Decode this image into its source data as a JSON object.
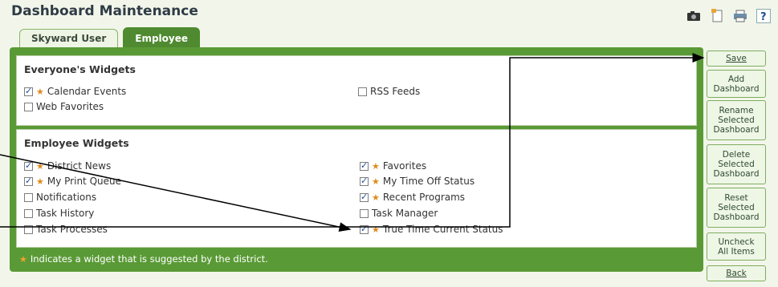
{
  "header": {
    "title": "Dashboard Maintenance"
  },
  "toolbar_icons": [
    "camera-icon",
    "page-icon",
    "print-icon",
    "help-icon"
  ],
  "tabs": [
    {
      "label": "Skyward User"
    },
    {
      "label": "Employee"
    }
  ],
  "everyone": {
    "heading": "Everyone's Widgets",
    "items": [
      {
        "label": "Calendar Events",
        "checked": true,
        "suggested": true
      },
      {
        "label": "Web Favorites",
        "checked": false,
        "suggested": false
      },
      {
        "label": "RSS Feeds",
        "checked": false,
        "suggested": false
      }
    ]
  },
  "employee": {
    "heading": "Employee Widgets",
    "items": [
      {
        "label": "District News",
        "checked": true,
        "suggested": true
      },
      {
        "label": "My Print Queue",
        "checked": true,
        "suggested": true
      },
      {
        "label": "Notifications",
        "checked": false,
        "suggested": false
      },
      {
        "label": "Task History",
        "checked": false,
        "suggested": false
      },
      {
        "label": "Task Processes",
        "checked": false,
        "suggested": false
      },
      {
        "label": "Favorites",
        "checked": true,
        "suggested": true
      },
      {
        "label": "My Time Off Status",
        "checked": true,
        "suggested": true
      },
      {
        "label": "Recent Programs",
        "checked": true,
        "suggested": true
      },
      {
        "label": "Task Manager",
        "checked": false,
        "suggested": false
      },
      {
        "label": "True Time Current Status",
        "checked": true,
        "suggested": true
      }
    ]
  },
  "legend": {
    "text": "Indicates a widget that is suggested by the district."
  },
  "buttons": {
    "save": "Save",
    "add": [
      "Add",
      "Dashboard"
    ],
    "rename": [
      "Rename",
      "Selected",
      "Dashboard"
    ],
    "delete": [
      "Delete",
      "Selected",
      "Dashboard"
    ],
    "reset": [
      "Reset",
      "Selected",
      "Dashboard"
    ],
    "uncheck": [
      "Uncheck",
      "All Items"
    ],
    "back": "Back"
  }
}
